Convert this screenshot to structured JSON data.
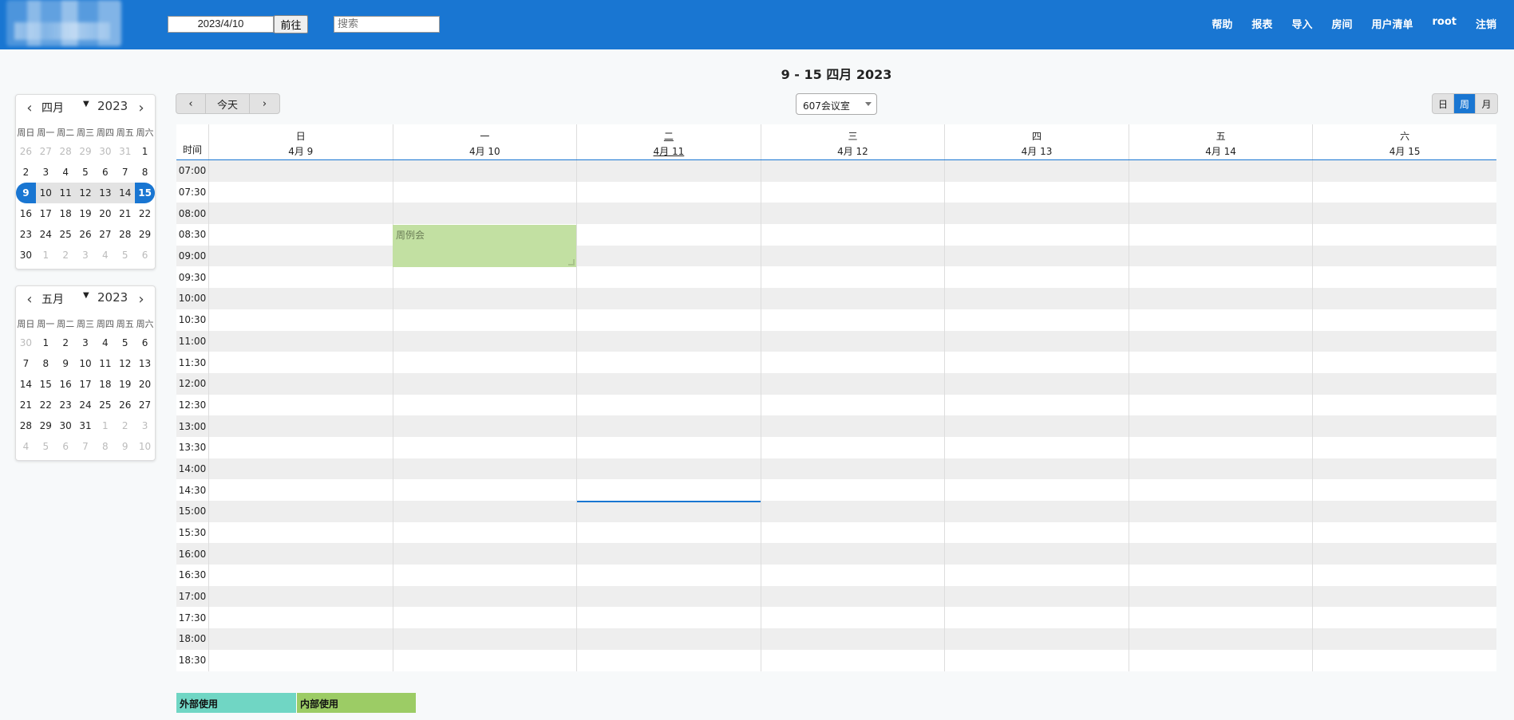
{
  "header": {
    "date_value": "2023/4/10",
    "goto_label": "前往",
    "search_placeholder": "搜索",
    "nav": [
      "帮助",
      "报表",
      "导入",
      "房间",
      "用户清单",
      "root",
      "注销"
    ],
    "brand_color": "#1976d2"
  },
  "week_title": "9 - 15 四月 2023",
  "mini_cal_april": {
    "month": "四月",
    "year": "2023",
    "dow": [
      "周日",
      "周一",
      "周二",
      "周三",
      "周四",
      "周五",
      "周六"
    ],
    "days": [
      "26",
      "27",
      "28",
      "29",
      "30",
      "31",
      "1",
      "2",
      "3",
      "4",
      "5",
      "6",
      "7",
      "8",
      "9",
      "10",
      "11",
      "12",
      "13",
      "14",
      "15",
      "16",
      "17",
      "18",
      "19",
      "20",
      "21",
      "22",
      "23",
      "24",
      "25",
      "26",
      "27",
      "28",
      "29",
      "30",
      "1",
      "2",
      "3",
      "4",
      "5",
      "6"
    ]
  },
  "mini_cal_may": {
    "month": "五月",
    "year": "2023",
    "dow": [
      "周日",
      "周一",
      "周二",
      "周三",
      "周四",
      "周五",
      "周六"
    ],
    "days": [
      "30",
      "1",
      "2",
      "3",
      "4",
      "5",
      "6",
      "7",
      "8",
      "9",
      "10",
      "11",
      "12",
      "13",
      "14",
      "15",
      "16",
      "17",
      "18",
      "19",
      "20",
      "21",
      "22",
      "23",
      "24",
      "25",
      "26",
      "27",
      "28",
      "29",
      "30",
      "31",
      "1",
      "2",
      "3",
      "4",
      "5",
      "6",
      "7",
      "8",
      "9",
      "10"
    ]
  },
  "toolbar": {
    "prev_icon": "chevron-left-icon",
    "today_label": "今天",
    "next_icon": "chevron-right-icon",
    "room": "607会议室",
    "views": [
      "日",
      "周",
      "月"
    ],
    "active_view": "周"
  },
  "grid": {
    "time_header": "时间",
    "days": [
      {
        "dow": "日",
        "date": "4月 9"
      },
      {
        "dow": "一",
        "date": "4月 10"
      },
      {
        "dow": "二",
        "date": "4月 11"
      },
      {
        "dow": "三",
        "date": "4月 12"
      },
      {
        "dow": "四",
        "date": "4月 13"
      },
      {
        "dow": "五",
        "date": "4月 14"
      },
      {
        "dow": "六",
        "date": "4月 15"
      }
    ],
    "times": [
      "07:00",
      "07:30",
      "08:00",
      "08:30",
      "09:00",
      "09:30",
      "10:00",
      "10:30",
      "11:00",
      "11:30",
      "12:00",
      "12:30",
      "13:00",
      "13:30",
      "14:00",
      "14:30",
      "15:00",
      "15:30",
      "16:00",
      "16:30",
      "17:00",
      "17:30",
      "18:00",
      "18:30"
    ]
  },
  "event": {
    "title": "周例会",
    "color": "#c2e0a2"
  },
  "legend": {
    "external": {
      "label": "外部使用",
      "color": "#70d6c4"
    },
    "internal": {
      "label": "内部使用",
      "color": "#9ccc65"
    }
  }
}
